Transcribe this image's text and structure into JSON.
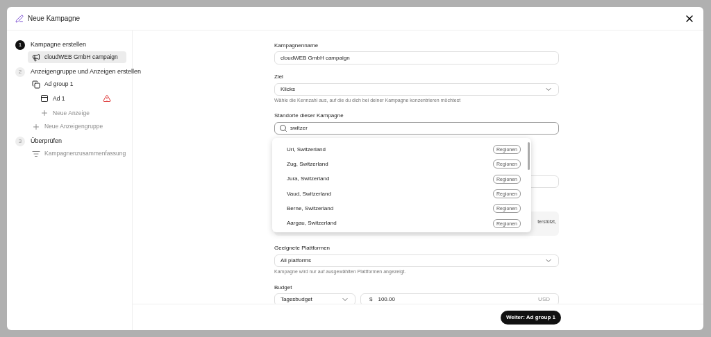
{
  "window": {
    "title": "Neue Kampagne"
  },
  "steps": [
    {
      "number": "1",
      "label": "Kampagne erstellen",
      "selected": true,
      "items": [
        {
          "kind": "campaign",
          "label": "cloudWEB GmbH campaign",
          "selected": true,
          "warning": false
        }
      ]
    },
    {
      "number": "2",
      "label": "Anzeigengruppe und Anzeigen erstellen",
      "selected": false,
      "items": [
        {
          "kind": "group",
          "label": "Ad group 1",
          "selected": false,
          "warning": false,
          "children": [
            {
              "kind": "ad",
              "label": "Ad 1",
              "selected": false,
              "warning": true
            },
            {
              "kind": "add",
              "label": "Neue Anzeige",
              "selected": false,
              "warning": false
            }
          ]
        },
        {
          "kind": "add",
          "label": "Neue Anzeigengruppe",
          "selected": false,
          "warning": false
        }
      ]
    },
    {
      "number": "3",
      "label": "Überprüfen",
      "selected": false,
      "items": [
        {
          "kind": "summary",
          "label": "Kampagnenzusammenfassung",
          "selected": false,
          "warning": false
        }
      ]
    }
  ],
  "form": {
    "campaign_name": {
      "label": "Kampagnenname",
      "value": "cloudWEB GmbH campaign"
    },
    "goal": {
      "label": "Ziel",
      "value": "Klicks",
      "hint": "Wähle die Kennzahl aus, auf die du dich bei deiner Kampagne konzentrieren möchtest"
    },
    "locations": {
      "label": "Standorte dieser Kampagne",
      "value": "switzer"
    },
    "info_text": "terstützt,",
    "platforms": {
      "label": "Geeignete Plattformen",
      "value": "All platforms",
      "hint": "Kampagne wird nur auf ausgewählten Plattformen angezeigt."
    },
    "budget": {
      "label": "Budget",
      "type": "Tagesbudget",
      "currency_symbol": "$",
      "amount": "100.00",
      "currency": "USD"
    }
  },
  "location_suggestions": [
    {
      "name": "Uri, Switzerland",
      "tag": "Regionen"
    },
    {
      "name": "Zug, Switzerland",
      "tag": "Regionen"
    },
    {
      "name": "Jura, Switzerland",
      "tag": "Regionen"
    },
    {
      "name": "Vaud, Switzerland",
      "tag": "Regionen"
    },
    {
      "name": "Berne, Switzerland",
      "tag": "Regionen"
    },
    {
      "name": "Aargau, Switzerland",
      "tag": "Regionen"
    }
  ],
  "next_button": "Weiter: Ad group 1"
}
